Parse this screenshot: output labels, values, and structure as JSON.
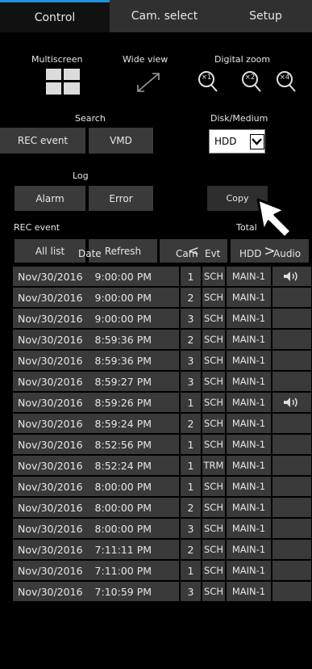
{
  "tabs": [
    {
      "label": "Control",
      "active": true
    },
    {
      "label": "Cam. select",
      "active": false
    },
    {
      "label": "Setup",
      "active": false
    }
  ],
  "multiscreen": {
    "label": "Multiscreen"
  },
  "wide_view": {
    "label": "Wide view"
  },
  "digital_zoom": {
    "label": "Digital zoom",
    "levels": [
      "×1",
      "×2",
      "×4"
    ]
  },
  "search": {
    "label": "Search",
    "rec_event": "REC event",
    "vmd": "VMD"
  },
  "disk": {
    "label": "Disk/Medium",
    "selected": "HDD"
  },
  "log": {
    "label": "Log",
    "alarm": "Alarm",
    "error": "Error"
  },
  "copy": {
    "label": "Copy"
  },
  "rec_event_section": {
    "label": "REC event",
    "total_label": "Total",
    "all_list": "All list",
    "refresh": "Refresh",
    "prev": "<",
    "next": ">"
  },
  "table": {
    "headers": {
      "date": "Date",
      "cam": "Cam",
      "evt": "Evt",
      "hdd": "HDD",
      "audio": "Audio"
    },
    "rows": [
      {
        "date": "Nov/30/2016",
        "time": "9:00:00 PM",
        "cam": "1",
        "evt": "SCH",
        "hdd": "MAIN-1",
        "audio": true
      },
      {
        "date": "Nov/30/2016",
        "time": "9:00:00 PM",
        "cam": "2",
        "evt": "SCH",
        "hdd": "MAIN-1",
        "audio": false
      },
      {
        "date": "Nov/30/2016",
        "time": "9:00:00 PM",
        "cam": "3",
        "evt": "SCH",
        "hdd": "MAIN-1",
        "audio": false
      },
      {
        "date": "Nov/30/2016",
        "time": "8:59:36 PM",
        "cam": "2",
        "evt": "SCH",
        "hdd": "MAIN-1",
        "audio": false
      },
      {
        "date": "Nov/30/2016",
        "time": "8:59:36 PM",
        "cam": "3",
        "evt": "SCH",
        "hdd": "MAIN-1",
        "audio": false
      },
      {
        "date": "Nov/30/2016",
        "time": "8:59:27 PM",
        "cam": "3",
        "evt": "SCH",
        "hdd": "MAIN-1",
        "audio": false
      },
      {
        "date": "Nov/30/2016",
        "time": "8:59:26 PM",
        "cam": "1",
        "evt": "SCH",
        "hdd": "MAIN-1",
        "audio": true
      },
      {
        "date": "Nov/30/2016",
        "time": "8:59:24 PM",
        "cam": "2",
        "evt": "SCH",
        "hdd": "MAIN-1",
        "audio": false
      },
      {
        "date": "Nov/30/2016",
        "time": "8:52:56 PM",
        "cam": "1",
        "evt": "SCH",
        "hdd": "MAIN-1",
        "audio": false
      },
      {
        "date": "Nov/30/2016",
        "time": "8:52:24 PM",
        "cam": "1",
        "evt": "TRM",
        "hdd": "MAIN-1",
        "audio": false
      },
      {
        "date": "Nov/30/2016",
        "time": "8:00:00 PM",
        "cam": "1",
        "evt": "SCH",
        "hdd": "MAIN-1",
        "audio": false
      },
      {
        "date": "Nov/30/2016",
        "time": "8:00:00 PM",
        "cam": "2",
        "evt": "SCH",
        "hdd": "MAIN-1",
        "audio": false
      },
      {
        "date": "Nov/30/2016",
        "time": "8:00:00 PM",
        "cam": "3",
        "evt": "SCH",
        "hdd": "MAIN-1",
        "audio": false
      },
      {
        "date": "Nov/30/2016",
        "time": "7:11:11 PM",
        "cam": "2",
        "evt": "SCH",
        "hdd": "MAIN-1",
        "audio": false
      },
      {
        "date": "Nov/30/2016",
        "time": "7:11:00 PM",
        "cam": "1",
        "evt": "SCH",
        "hdd": "MAIN-1",
        "audio": false
      },
      {
        "date": "Nov/30/2016",
        "time": "7:10:59 PM",
        "cam": "3",
        "evt": "SCH",
        "hdd": "MAIN-1",
        "audio": false
      }
    ]
  },
  "icons": {
    "multiscreen": "grid-icon",
    "wide_view": "expand-arrow-icon",
    "zoom": "magnifier-icon",
    "audio": "speaker-icon",
    "pointer": "mouse-pointer-arrow-icon",
    "disk_dropdown": "chevron-down-icon"
  },
  "colors": {
    "accent": "#1f8fe0",
    "button_bg": "#3a3a3a",
    "tab_bg": "#303030",
    "background": "#000000"
  }
}
